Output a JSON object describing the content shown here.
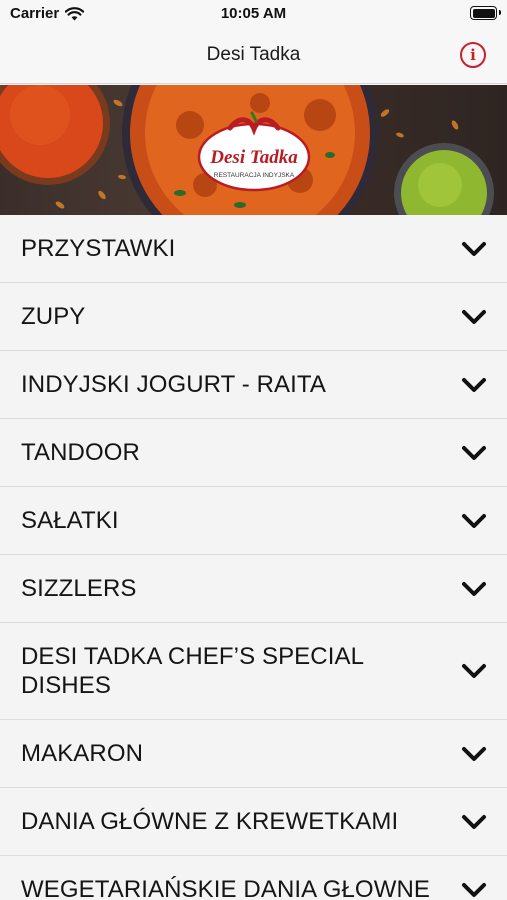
{
  "status_bar": {
    "carrier": "Carrier",
    "time": "10:05 AM"
  },
  "nav": {
    "title": "Desi Tadka",
    "info_icon": "info-circle-icon",
    "accent_color": "#c8202a"
  },
  "banner": {
    "logo_title": "Desi Tadka",
    "logo_subtitle": "RESTAURACJA INDYJSKA"
  },
  "menu": {
    "items": [
      {
        "label": "PRZYSTAWKI"
      },
      {
        "label": "ZUPY"
      },
      {
        "label": "INDYJSKI JOGURT - RAITA"
      },
      {
        "label": "TANDOOR"
      },
      {
        "label": "SAŁATKI"
      },
      {
        "label": "SIZZLERS"
      },
      {
        "label": "DESI TADKA CHEF’S SPECIAL DISHES"
      },
      {
        "label": "MAKARON"
      },
      {
        "label": "DANIA GŁÓWNE Z KREWETKAMI"
      },
      {
        "label": "WEGETARIAŃSKIE DANIA GŁOWNE"
      }
    ]
  }
}
